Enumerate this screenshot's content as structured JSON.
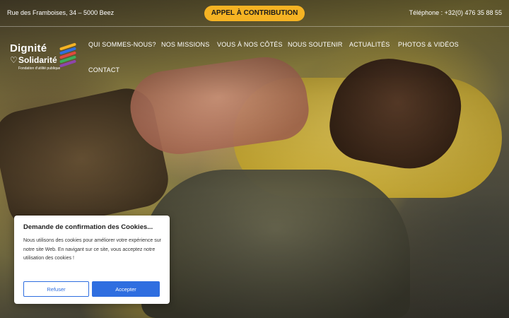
{
  "topbar": {
    "address": "Rue des Framboises, 34 – 5000 Beez",
    "cta_label": "APPEL À CONTRIBUTION",
    "phone": "Téléphone : +32(0) 476 35 88 55"
  },
  "logo": {
    "line1": "Dignité",
    "line2": "Solidarité",
    "tagline": "Fondation d'utilité publique",
    "stripe_colors": [
      "#f5b323",
      "#2f6ee0",
      "#e2483d",
      "#3cae5a",
      "#8e44ad"
    ]
  },
  "nav": {
    "items": [
      {
        "label": "QUI SOMMES-NOUS?"
      },
      {
        "label": "NOS MISSIONS"
      },
      {
        "label": "VOUS À NOS CÔTÉS"
      },
      {
        "label": "NOUS SOUTENIR"
      },
      {
        "label": "ACTUALITÉS"
      },
      {
        "label": "PHOTOS & VIDÉOS"
      },
      {
        "label": "CONTACT"
      }
    ]
  },
  "cookie": {
    "title": "Demande de confirmation des Cookies...",
    "text": "Nous utilisons des cookies pour améliorer votre expérience sur notre site Web. En navigant sur ce site, vous acceptez notre utilisation des cookies !",
    "refuse_label": "Refuser",
    "accept_label": "Accepter"
  },
  "colors": {
    "accent": "#f5b323",
    "primary_blue": "#2f6ee0"
  }
}
